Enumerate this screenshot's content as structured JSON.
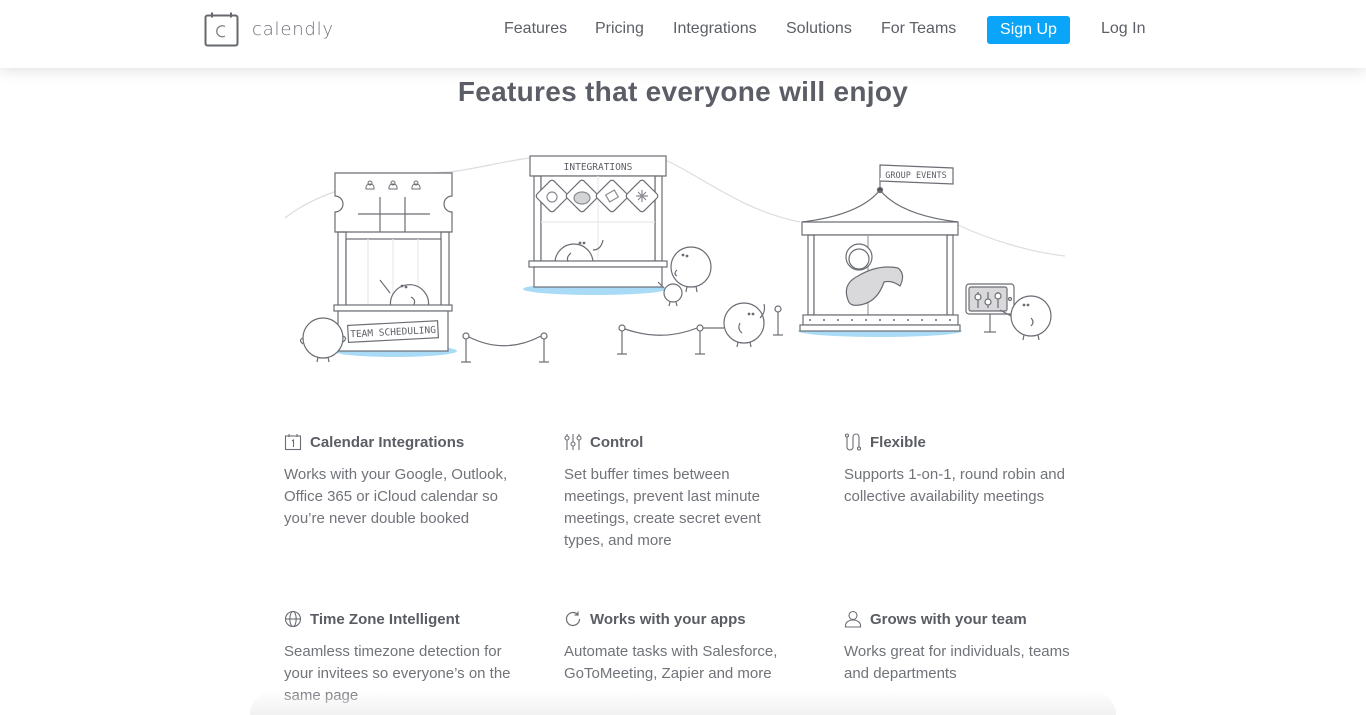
{
  "nav": {
    "brand": "calendly",
    "links": [
      {
        "label": "Features"
      },
      {
        "label": "Pricing"
      },
      {
        "label": "Integrations"
      },
      {
        "label": "Solutions"
      },
      {
        "label": "For Teams"
      }
    ],
    "signup_label": "Sign Up",
    "login_label": "Log In",
    "accent_color": "#0aa5f8"
  },
  "main": {
    "title": "Features that everyone will enjoy",
    "illustration": {
      "booth_signs": [
        "TEAM SCHEDULING",
        "INTEGRATIONS",
        "GROUP EVENTS"
      ]
    },
    "features": [
      {
        "icon": "calendar-icon",
        "title": "Calendar Integrations",
        "description": "Works with your Google, Outlook, Office 365 or iCloud calendar so you’re never double booked"
      },
      {
        "icon": "sliders-icon",
        "title": "Control",
        "description": "Set buffer times between meetings, prevent last minute meetings, create secret event types, and more"
      },
      {
        "icon": "flexible-path-icon",
        "title": "Flexible",
        "description": "Supports 1-on-1, round robin and collective availability meetings"
      },
      {
        "icon": "globe-icon",
        "title": "Time Zone Intelligent",
        "description": "Seamless timezone detection for your invitees so everyone’s on the same page"
      },
      {
        "icon": "refresh-icon",
        "title": "Works with your apps",
        "description": "Automate tasks with Salesforce, GoToMeeting, Zapier and more"
      },
      {
        "icon": "user-icon",
        "title": "Grows with your team",
        "description": "Works great for individuals, teams and departments"
      }
    ]
  }
}
